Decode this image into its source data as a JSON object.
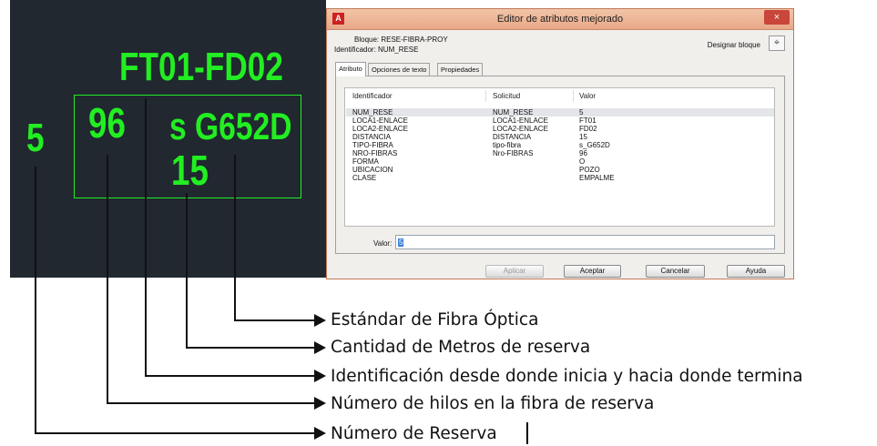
{
  "cad": {
    "title": "FT01-FD02",
    "fiber_count": "96",
    "standard": "s G652D",
    "distance": "15",
    "reserve_number": "5"
  },
  "dialog": {
    "title": "Editor de atributos mejorado",
    "close_label": "×",
    "block_label": "Bloque: RESE-FIBRA-PROY",
    "identifier_label": "Identificador: NUM_RESE",
    "designar_label": "Designar bloque",
    "tabs": [
      "Atributo",
      "Opciones de texto",
      "Propiedades"
    ],
    "table": {
      "headers": [
        "Identificador",
        "Solicitud",
        "Valor"
      ],
      "rows": [
        [
          "NUM_RESE",
          "NUM_RESE",
          "5"
        ],
        [
          "LOCA1-ENLACE",
          "LOCA1-ENLACE",
          "FT01"
        ],
        [
          "LOCA2-ENLACE",
          "LOCA2-ENLACE",
          "FD02"
        ],
        [
          "DISTANCIA",
          "DISTANCIA",
          "15"
        ],
        [
          "TIPO-FIBRA",
          "tipo-fibra",
          "s_G652D"
        ],
        [
          "NRO-FIBRAS",
          "Nro-FIBRAS",
          "96"
        ],
        [
          "FORMA",
          "",
          "O"
        ],
        [
          "UBICACION",
          "",
          "POZO"
        ],
        [
          "CLASE",
          "",
          "EMPALME"
        ]
      ]
    },
    "valor_label": "Valor:",
    "valor_value": "5",
    "buttons": {
      "apply": "Aplicar",
      "accept": "Aceptar",
      "cancel": "Cancelar",
      "help": "Ayuda"
    }
  },
  "annotations": [
    "Estándar de Fibra Óptica",
    "Cantidad de Metros de reserva",
    "Identificación desde donde inicia y hacia donde termina",
    "Número de hilos en la fibra de reserva",
    "Número de Reserva"
  ],
  "colors": {
    "cad_background": "#212830",
    "cad_text": "#22ee22",
    "titlebar": "#eeb596",
    "close_button": "#c9463a"
  }
}
